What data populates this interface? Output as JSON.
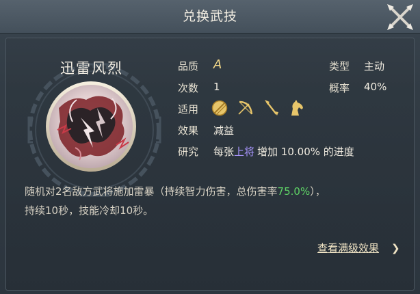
{
  "header": {
    "title": "兑换武技"
  },
  "skill": {
    "name": "迅雷风烈"
  },
  "stats": {
    "quality_label": "品质",
    "quality_value": "A",
    "count_label": "次数",
    "count_value": "1",
    "apply_label": "适用",
    "effect_label": "效果",
    "effect_value": "减益",
    "research_label": "研究",
    "research_pre": "每张",
    "research_highlight": "上将",
    "research_post": "增加 10.00% 的进度",
    "type_label": "类型",
    "type_value": "主动",
    "rate_label": "概率",
    "rate_value": "40%"
  },
  "weapons": [
    "shield-weapon-icon",
    "bow-weapon-icon",
    "spear-weapon-icon",
    "horse-weapon-icon"
  ],
  "description": {
    "text1": "随机对2名敌方武将施加雷暴（持续智力伤害，总伤害率",
    "highlight": "75.0%",
    "text2": "），",
    "line2": "持续10秒，技能冷却10秒。"
  },
  "footer": {
    "link": "查看满级效果",
    "chevron": "❯"
  },
  "colors": {
    "accent_green": "#5fd466",
    "accent_purple": "#a996ff",
    "quality_gold": "#f4d98a"
  }
}
